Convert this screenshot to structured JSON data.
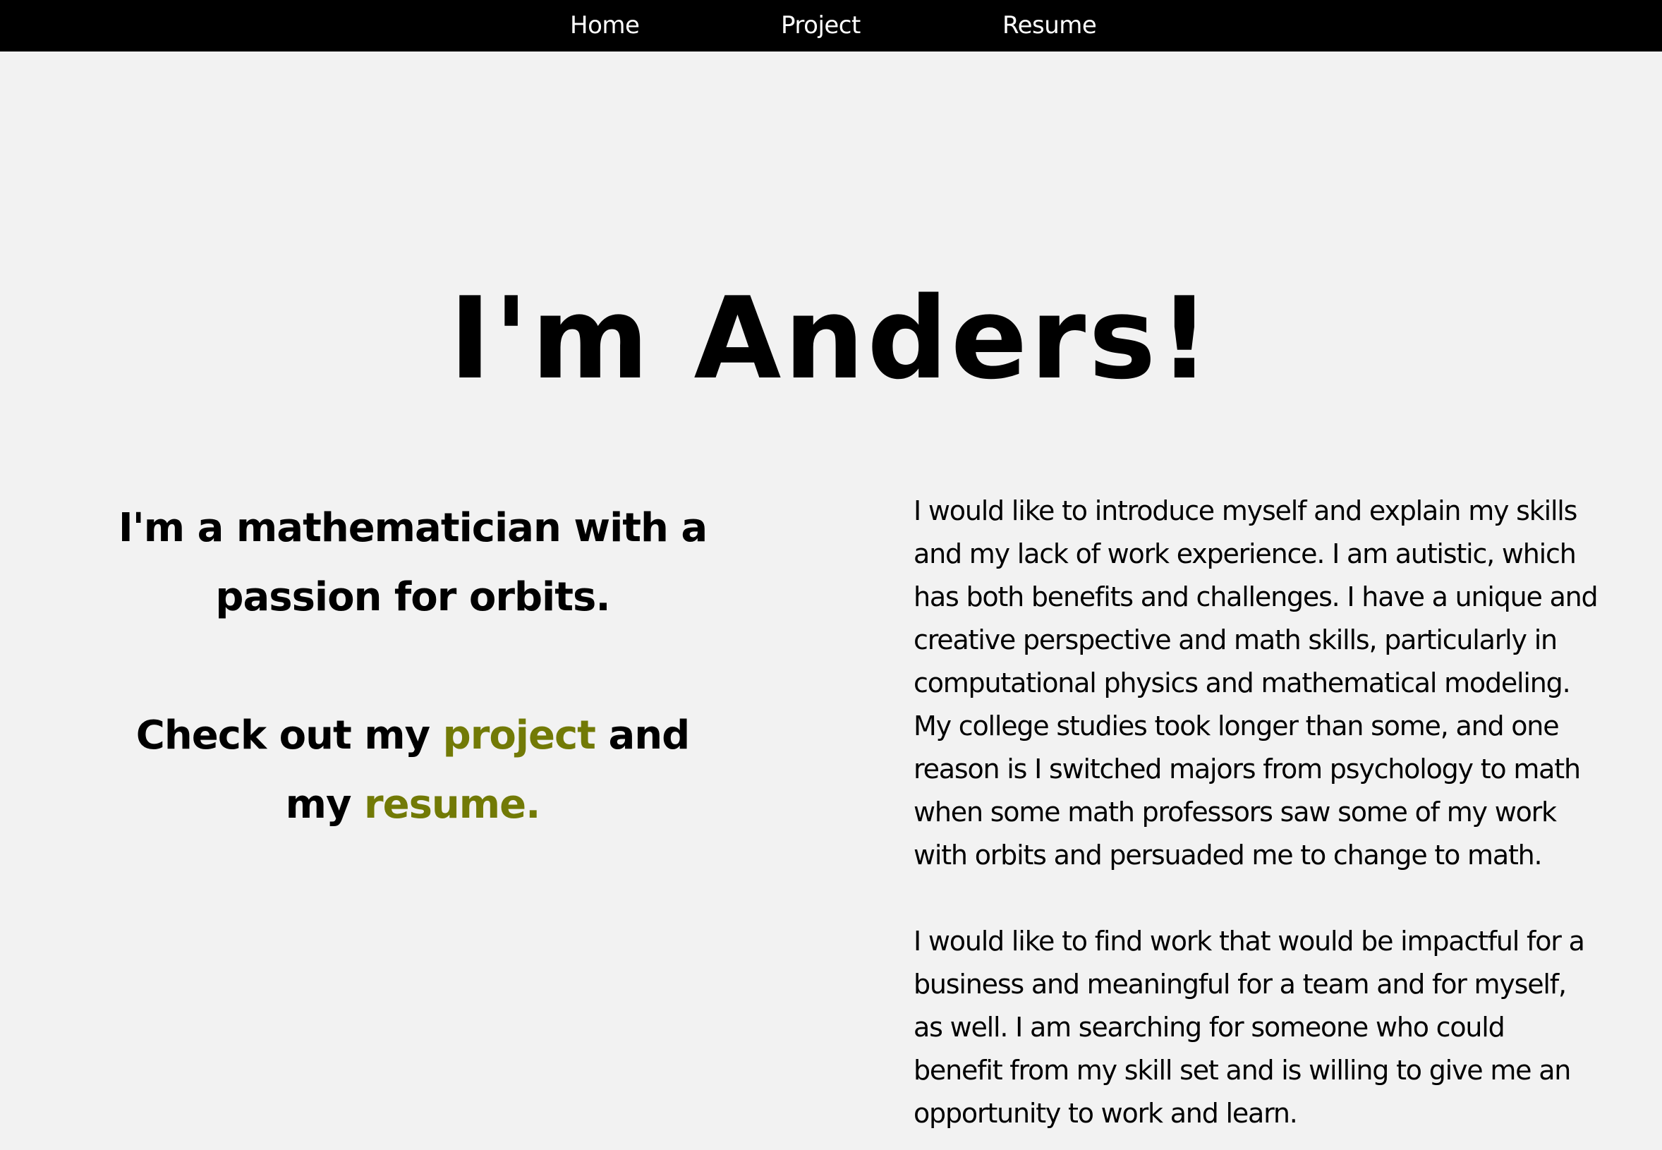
{
  "nav": {
    "home": "Home",
    "project": "Project",
    "resume": "Resume"
  },
  "hero": {
    "title": "I'm Anders!"
  },
  "left": {
    "tagline": "I'm a mathematician with a passion for orbits.",
    "cta_prefix": "Check out my ",
    "cta_project": "project",
    "cta_middle": " and my ",
    "cta_resume": "resume."
  },
  "right": {
    "paragraph1": "I would like to introduce myself and explain my skills and my lack of work experience. I am autistic, which has both benefits and challenges. I have a unique and creative perspective and math skills, particularly in computational physics and mathematical modeling. My college studies took longer than some, and one reason is I switched majors from psychology to math when some math professors saw some of my work with orbits and persuaded me to change to math.",
    "paragraph2": "I would like to find work that would be impactful for a business and meaningful for a team and for myself, as well. I am searching for someone who could benefit from my skill set and is willing to give me an opportunity to work and learn."
  },
  "colors": {
    "nav_background": "#000000",
    "page_background": "#f2f2f2",
    "accent": "#727a06",
    "text": "#000000"
  }
}
